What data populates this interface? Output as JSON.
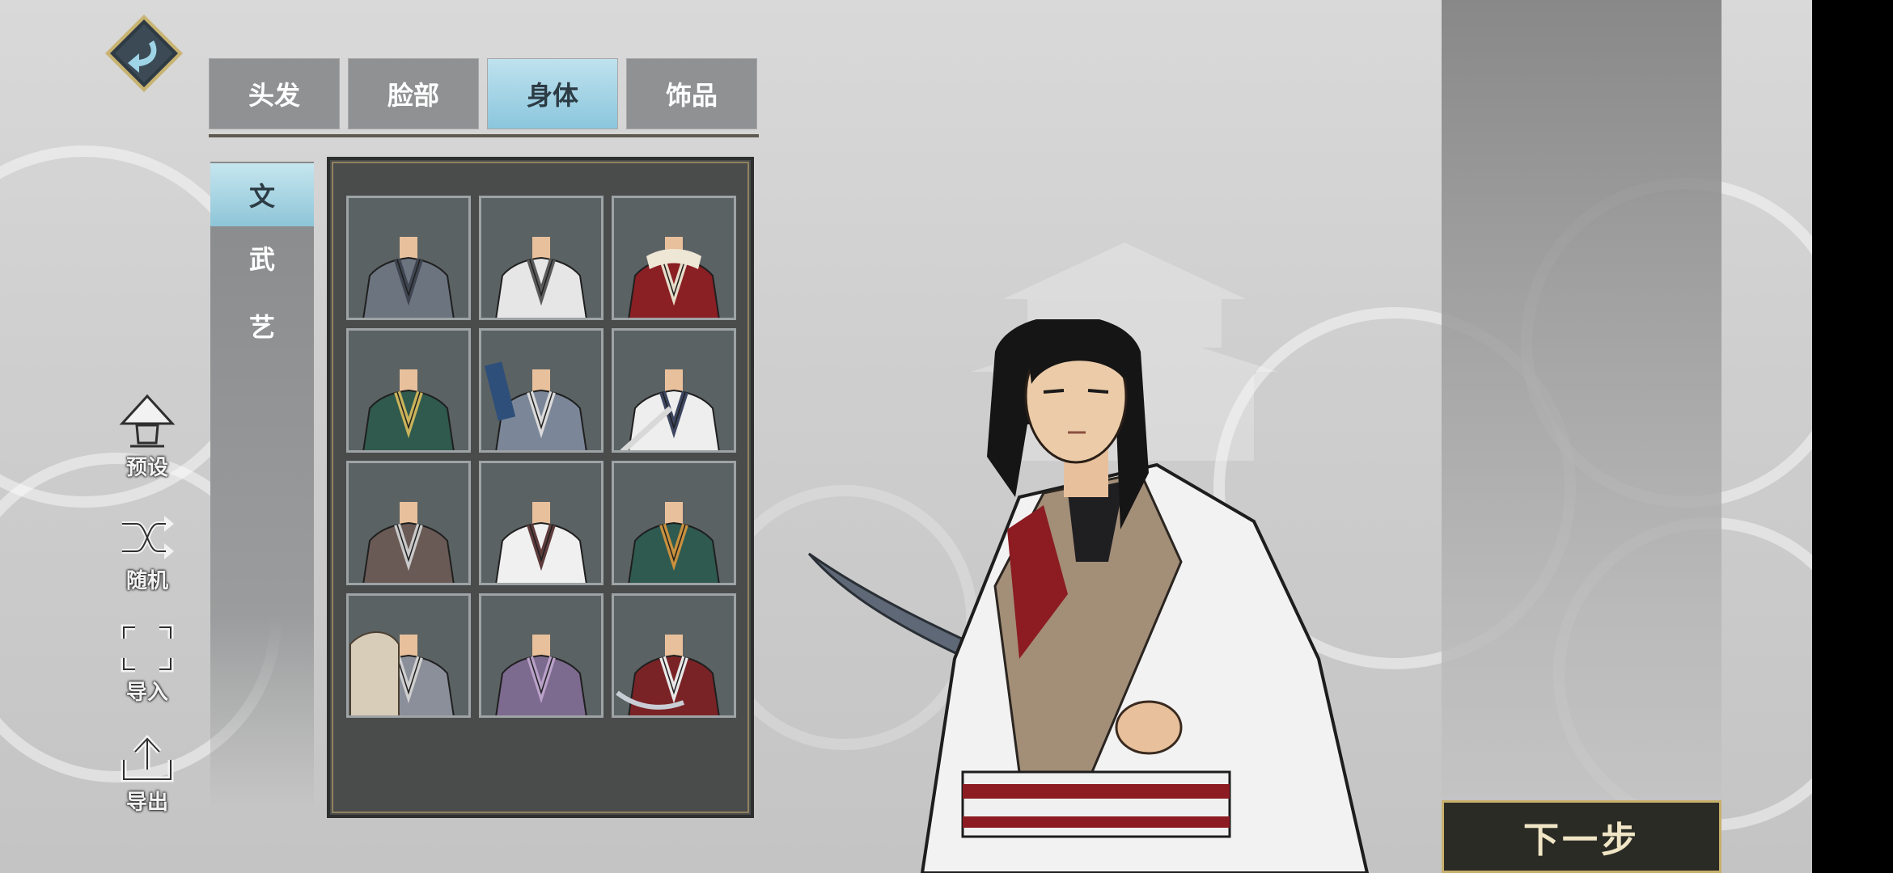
{
  "tabs": [
    {
      "label": "头发",
      "active": false
    },
    {
      "label": "脸部",
      "active": false
    },
    {
      "label": "身体",
      "active": true
    },
    {
      "label": "饰品",
      "active": false
    }
  ],
  "subcategories": [
    {
      "label": "文",
      "active": true
    },
    {
      "label": "武",
      "active": false
    },
    {
      "label": "艺",
      "active": false
    }
  ],
  "tools": [
    {
      "label": "预设",
      "icon": "straw-hat-icon"
    },
    {
      "label": "随机",
      "icon": "shuffle-icon"
    },
    {
      "label": "导入",
      "icon": "import-frame-icon"
    },
    {
      "label": "导出",
      "icon": "export-upload-icon"
    }
  ],
  "outfits": [
    {
      "robe": "#6c7480",
      "trim": "#3f4550",
      "prop": ""
    },
    {
      "robe": "#e6e6e6",
      "trim": "#5a5a5a",
      "prop": ""
    },
    {
      "robe": "#8a1f24",
      "trim": "#e6dcc8",
      "prop": "fur"
    },
    {
      "robe": "#2f5a4d",
      "trim": "#c9b35a",
      "prop": ""
    },
    {
      "robe": "#7b8798",
      "trim": "#d9d9d9",
      "prop": "book"
    },
    {
      "robe": "#eeeeee",
      "trim": "#3d4660",
      "prop": "sword"
    },
    {
      "robe": "#6a5a55",
      "trim": "#c9c9c9",
      "prop": ""
    },
    {
      "robe": "#f0f0f0",
      "trim": "#5e3b3b",
      "prop": ""
    },
    {
      "robe": "#2f5a50",
      "trim": "#c8903d",
      "prop": ""
    },
    {
      "robe": "#8a8f9a",
      "trim": "#cfcfcf",
      "prop": "fan"
    },
    {
      "robe": "#7d6a8f",
      "trim": "#b9a0c8",
      "prop": ""
    },
    {
      "robe": "#7a2326",
      "trim": "#e8e8e8",
      "prop": "blade"
    }
  ],
  "next_button": "下一步",
  "colors": {
    "accent_tab": "#8bc6dd",
    "gold_trim": "#c7b06d"
  }
}
